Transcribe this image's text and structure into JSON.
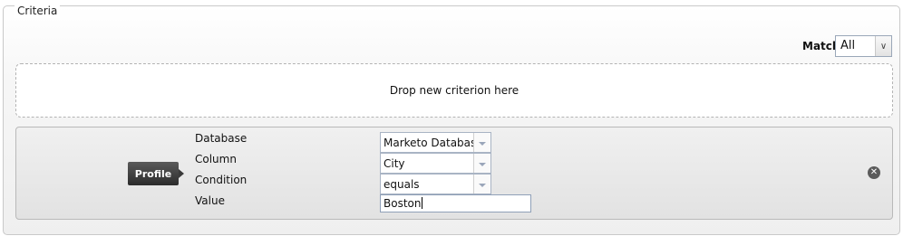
{
  "fieldset": {
    "legend": "Criteria"
  },
  "match": {
    "label": "Match",
    "value": "All",
    "arrow_icon": "chevron-down-icon"
  },
  "dropzone": {
    "text": "Drop new criterion here"
  },
  "criterion": {
    "tag": "Profile",
    "fields": [
      {
        "label": "Database",
        "value": "Marketo Database",
        "type": "select"
      },
      {
        "label": "Column",
        "value": "City",
        "type": "select"
      },
      {
        "label": "Condition",
        "value": "equals",
        "type": "select"
      },
      {
        "label": "Value",
        "value": "Boston",
        "type": "text"
      }
    ],
    "remove_icon": "close-circle-icon"
  }
}
